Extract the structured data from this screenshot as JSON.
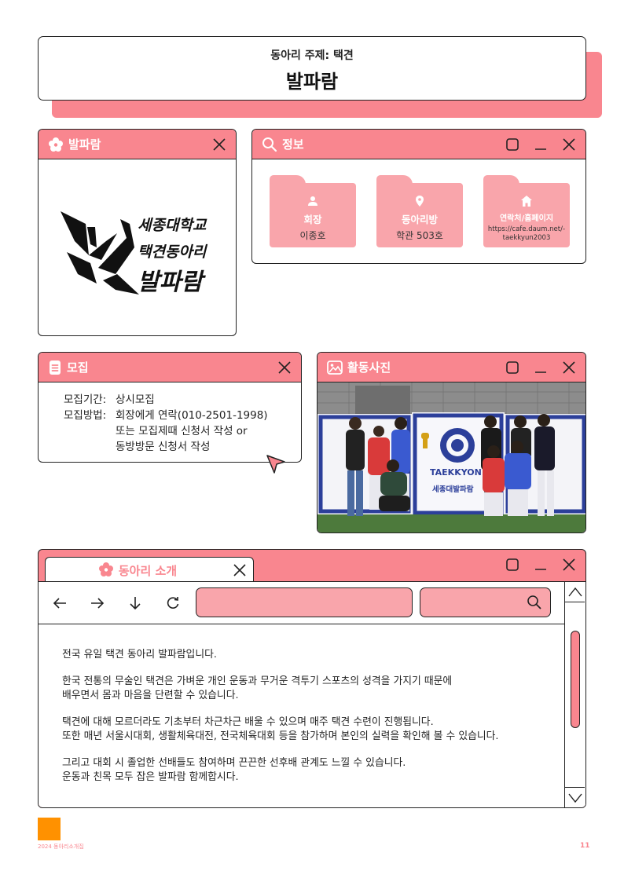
{
  "header": {
    "subtitle": "동아리 주제: 택견",
    "title": "발파람"
  },
  "logo_window": {
    "title": "발파람",
    "logo_lines": [
      "세종대학교",
      "택견동아리",
      "발파람"
    ]
  },
  "info_window": {
    "title": "정보",
    "folders": [
      {
        "icon": "person-icon",
        "label": "회장",
        "value": "이종호"
      },
      {
        "icon": "location-pin-icon",
        "label": "동아리방",
        "value": "학관 503호"
      },
      {
        "icon": "home-icon",
        "label": "연락처/홈페이지",
        "value_lines": [
          "https://cafe.daum.net/-",
          "taekkyun2003"
        ]
      }
    ]
  },
  "recruit_window": {
    "title": "모집",
    "period_label": "모집기간:",
    "period_value": "상시모집",
    "method_label": "모집방법:",
    "method_lines": [
      "회장에게 연락(010-2501-1998)",
      "또는 모집제때 신청서 작성 or",
      "동방방문 신청서 작성"
    ]
  },
  "photo_window": {
    "title": "활동사진",
    "banner_text": "TAEKKYON",
    "banner_subtext": "세종대발파람"
  },
  "intro_window": {
    "tab_title": "동아리 소개",
    "paragraphs": [
      [
        "전국 유일 택견 동아리 발파람입니다."
      ],
      [
        "한국 전통의 무술인 택견은 가벼운 개인 운동과 무거운 격투기 스포츠의 성격을 가지기 때문에",
        "배우면서 몸과 마음을 단련할 수 있습니다."
      ],
      [
        "택견에 대해 모르더라도 기초부터 차근차근 배울 수 있으며 매주 택견 수련이 진행됩니다.",
        "또한 매년 서울시대회, 생활체육대전, 전국체육대회 등을 참가하며 본인의 실력을 확인해 볼 수 있습니다."
      ],
      [
        "그리고 대회 시 졸업한 선배들도 참여하며 끈끈한 선후배 관계도 느낄 수 있습니다.",
        "운동과 친목 모두 잡은 발파람 함께합시다."
      ]
    ]
  },
  "footer": {
    "left_text": "2024 동아리소개집",
    "page_number": "11"
  },
  "colors": {
    "accent": "#f9868f",
    "accent_light": "#f9a5ab",
    "footer_square": "#ff9100"
  }
}
